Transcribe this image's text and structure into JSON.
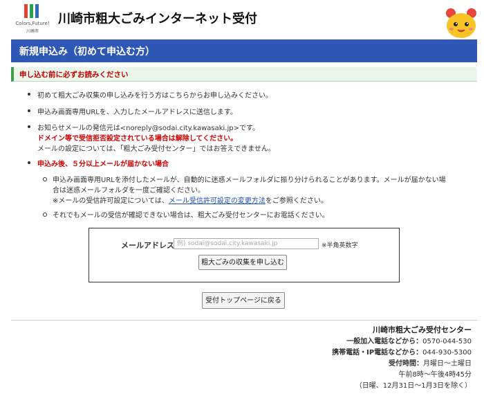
{
  "header": {
    "logo_tagline": "Colors,Future!",
    "logo_city": "川崎市",
    "site_title": "川崎市粗大ごみインターネット受付"
  },
  "page_title": "新規申込み（初めて申込む方）",
  "notice_heading": "申し込む前に必ずお読みください",
  "notices": {
    "item1": "初めて粗大ごみ収集の申し込みを行う方はこちらからお申し込みください。",
    "item2": "申込み画面専用URLを、入力したメールアドレスに送信します。",
    "item3_line1": "お知らせメールの発信元は<noreply@sodai.city.kawasaki.jp>です。",
    "item3_line2": "ドメイン等で受信拒否設定されている場合は解除してください。",
    "item3_line3": "メールの設定については、「粗大ごみ受付センター」ではお答えできません。",
    "item4": "申込み後、５分以上メールが届かない場合",
    "sub1_line1": "申込み画面専用URLを添付したメールが、自動的に迷惑メールフォルダに振り分けられることがあります。メールが届かない場",
    "sub1_line2": "合は迷惑メールフォルダを一度ご確認ください。",
    "sub1_line3_pre": "※メールの受信許可設定については、",
    "sub1_link": "メール受信許可設定の変更方法",
    "sub1_line3_post": "をご参照ください。",
    "sub2": "それでもメールの受信が確認できない場合は、粗大ごみ受付センターにお電話ください。"
  },
  "form": {
    "email_label": "メールアドレス",
    "email_placeholder": "例) sodai@sodai.city.kawasaki.jp",
    "email_value": "",
    "email_note": "※半角英数字",
    "submit_label": "粗大ごみの収集を申し込む"
  },
  "back_button_label": "受付トップページに戻る",
  "footer": {
    "center_name": "川崎市粗大ごみ受付センター",
    "phone1_label": "一般加入電話などから：",
    "phone1": "0570-044-530",
    "phone2_label": "携帯電話・IP電話などから：",
    "phone2": "044-930-5300",
    "hours_label": "受付時間：",
    "hours_days": "月曜日～土曜日",
    "hours_time": "午前8時～午後4時45分",
    "holidays": "（日曜、12月31日～1月3日を除く）"
  },
  "colors": {
    "title_bar": "#2f57b5",
    "notice_border": "#3f9e4d",
    "warning_text": "#d40000",
    "link": "#1a4fb5"
  }
}
